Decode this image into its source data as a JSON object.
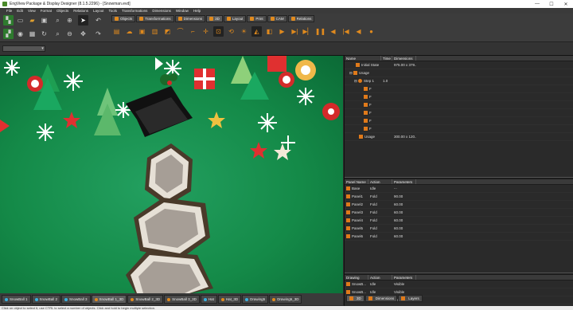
{
  "window": {
    "title": "EngView Package & Display Designer (8.1.5.2296) - [Snowman.evd]",
    "controls": [
      "—",
      "☐",
      "✕"
    ]
  },
  "menu": [
    "File",
    "Edit",
    "View",
    "Format",
    "Objects",
    "Relations",
    "Layout",
    "Tools",
    "Transformations",
    "Dimensions",
    "Window",
    "Help"
  ],
  "mode_tabs": [
    "Objects",
    "Transformations",
    "Dimensions",
    "3D",
    "Layout",
    "Print",
    "CAM",
    "Relations"
  ],
  "tree": {
    "columns": [
      "Name",
      "Time",
      "Dimensions"
    ],
    "rows": [
      {
        "name": "Initial State",
        "time": "",
        "dim": "975.00 x 379...."
      },
      {
        "name": "Usage",
        "time": "",
        "dim": ""
      },
      {
        "name": "Step 1",
        "time": "1.0",
        "dim": ""
      },
      {
        "name": "F",
        "time": "",
        "dim": ""
      },
      {
        "name": "F",
        "time": "",
        "dim": ""
      },
      {
        "name": "F",
        "time": "",
        "dim": ""
      },
      {
        "name": "F",
        "time": "",
        "dim": ""
      },
      {
        "name": "F",
        "time": "",
        "dim": ""
      },
      {
        "name": "F",
        "time": "",
        "dim": ""
      },
      {
        "name": "Usage",
        "time": "",
        "dim": "300.00 x 120...."
      }
    ]
  },
  "panels": {
    "columns": [
      "Panel Name",
      "Action",
      "Parameters ..."
    ],
    "rows": [
      {
        "name": "Base",
        "action": "Idle",
        "param": ""
      },
      {
        "name": "Panel1",
        "action": "Fold",
        "param": "90.00"
      },
      {
        "name": "Panel2",
        "action": "Fold",
        "param": "60.00"
      },
      {
        "name": "Panel3",
        "action": "Fold",
        "param": "60.00"
      },
      {
        "name": "Panel4",
        "action": "Fold",
        "param": "60.00"
      },
      {
        "name": "Panel5",
        "action": "Fold",
        "param": "60.00"
      },
      {
        "name": "Panel6",
        "action": "Fold",
        "param": "60.00"
      }
    ]
  },
  "drawings": {
    "columns": [
      "Drawing",
      "Action",
      "Parameters ..."
    ],
    "rows": [
      {
        "name": "SnowB...",
        "action": "Idle",
        "param": "Visible"
      },
      {
        "name": "SnowB...",
        "action": "Idle",
        "param": "Visible"
      },
      {
        "name": "SnowB...",
        "action": "Idle",
        "param": "Visible"
      }
    ]
  },
  "right_tabs": [
    "3D",
    "Dimensions",
    "Layers"
  ],
  "bottom_tabs": [
    "SnowBall 1",
    "SnowBall 2",
    "SnowBall 3",
    "SnowBall 1_3D",
    "SnowBall 2_3D",
    "SnowBall 3_3D",
    "Hat",
    "Hat_3D",
    "Drawing5",
    "Drawing5_3D"
  ],
  "status": "Click on object to select it, use CTRL to select a number of objects. Click and hold to begin multiple selection.",
  "colors": {
    "accent": "#e08a1e",
    "canvas": "#148a48"
  }
}
